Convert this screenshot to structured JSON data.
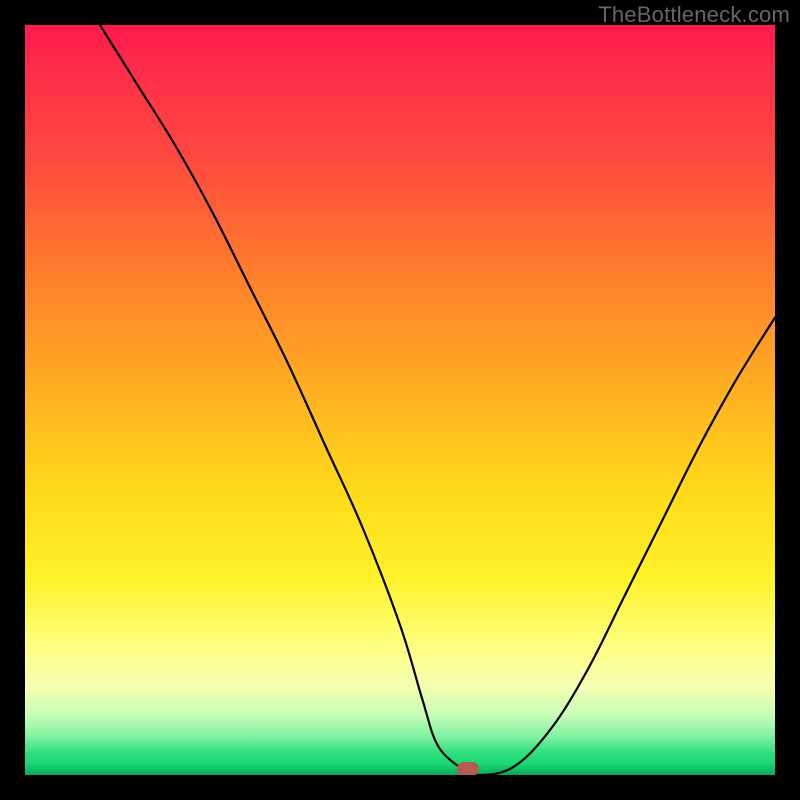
{
  "watermark": "TheBottleneck.com",
  "chart_data": {
    "type": "line",
    "title": "",
    "xlabel": "",
    "ylabel": "",
    "xlim": [
      0,
      100
    ],
    "ylim": [
      0,
      100
    ],
    "series": [
      {
        "name": "bottleneck-curve",
        "x": [
          10,
          15,
          20,
          25,
          30,
          35,
          40,
          45,
          50,
          53,
          55,
          58,
          60,
          65,
          70,
          75,
          80,
          85,
          90,
          95,
          100
        ],
        "y": [
          100,
          92,
          84,
          75,
          65,
          55,
          44,
          33,
          20,
          10,
          4,
          1,
          0,
          1,
          6,
          14,
          24,
          34,
          44,
          53,
          61
        ]
      }
    ],
    "marker": {
      "x": 59,
      "y": 0.8,
      "color": "#b85a52"
    },
    "gradient_stops": [
      {
        "pct": 0,
        "color": "#ff1a4d"
      },
      {
        "pct": 62,
        "color": "#ffd91a"
      },
      {
        "pct": 88,
        "color": "#f7ffb0"
      },
      {
        "pct": 100,
        "color": "#0aa858"
      }
    ]
  }
}
